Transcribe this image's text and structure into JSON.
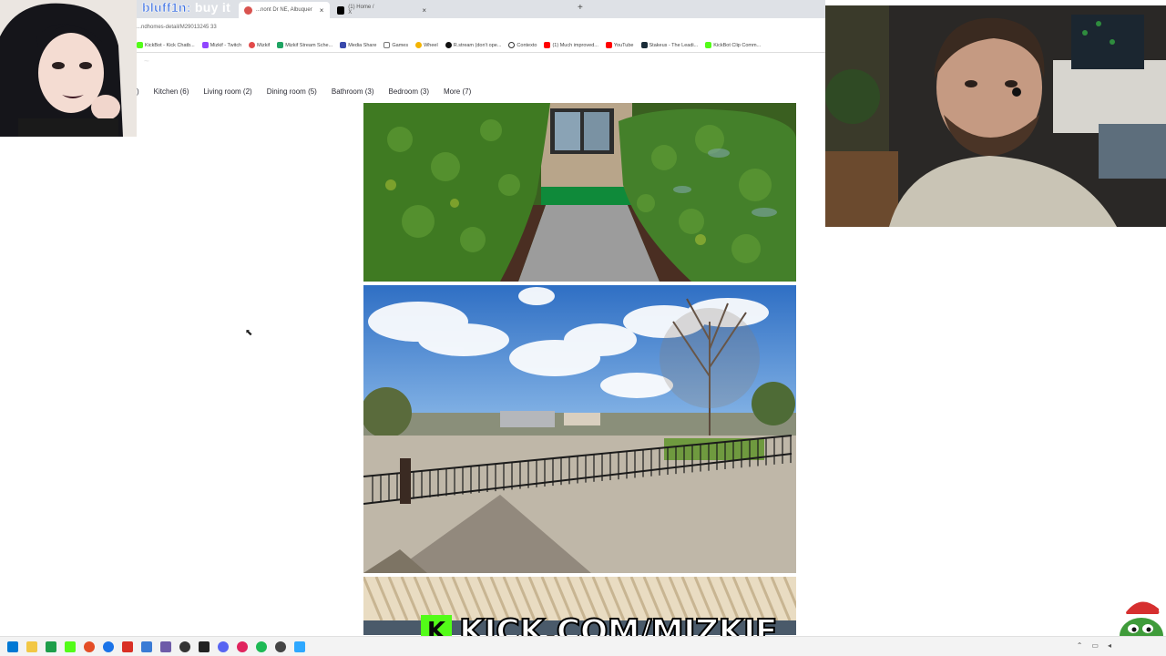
{
  "browser": {
    "tabs": [
      {
        "label": "...nont Dr NE, Albuquer",
        "active": true
      },
      {
        "label": "(1) Home / X",
        "active": false
      }
    ],
    "new_tab_glyph": "+",
    "close_glyph": "×",
    "url": "...ndhomes-detail/M29013245 33",
    "bookmarks": [
      {
        "label": "KickBot - Kick Chatb...",
        "icon": "kickbot-icon"
      },
      {
        "label": "Mizkif - Twitch",
        "icon": "twitch-icon"
      },
      {
        "label": "Mizkif",
        "icon": "mizkif-icon"
      },
      {
        "label": "Mizkif Stream Sche...",
        "icon": "sheets-icon"
      },
      {
        "label": "Media Share",
        "icon": "media-share-icon"
      },
      {
        "label": "Games",
        "icon": "folder-icon"
      },
      {
        "label": "Wheel",
        "icon": "wheel-icon"
      },
      {
        "label": "R.stream (don't ope...",
        "icon": "rstream-icon"
      },
      {
        "label": "Contexto",
        "icon": "contexto-icon"
      },
      {
        "label": "(1) Much improved...",
        "icon": "youtube-icon"
      },
      {
        "label": "YouTube",
        "icon": "youtube-icon"
      },
      {
        "label": "Stakeus - The Leadi...",
        "icon": "stake-icon"
      },
      {
        "label": "KickBot Clip Comm...",
        "icon": "kickbot-icon"
      }
    ]
  },
  "overlay": {
    "username": "bluff1n:",
    "message": " buy it"
  },
  "categories": {
    "lead": ")",
    "items": [
      {
        "label": "Kitchen (6)"
      },
      {
        "label": "Living room (2)"
      },
      {
        "label": "Dining room (5)"
      },
      {
        "label": "Bathroom (3)"
      },
      {
        "label": "Bedroom (3)"
      },
      {
        "label": "More (7)"
      }
    ]
  },
  "stream": {
    "banner": "KICK.COM/MIZKIF",
    "logo_letter": "K"
  },
  "colors": {
    "kick_green": "#53fc18",
    "hedge_green": "#3f7a22",
    "sky_blue": "#4a87d4"
  }
}
